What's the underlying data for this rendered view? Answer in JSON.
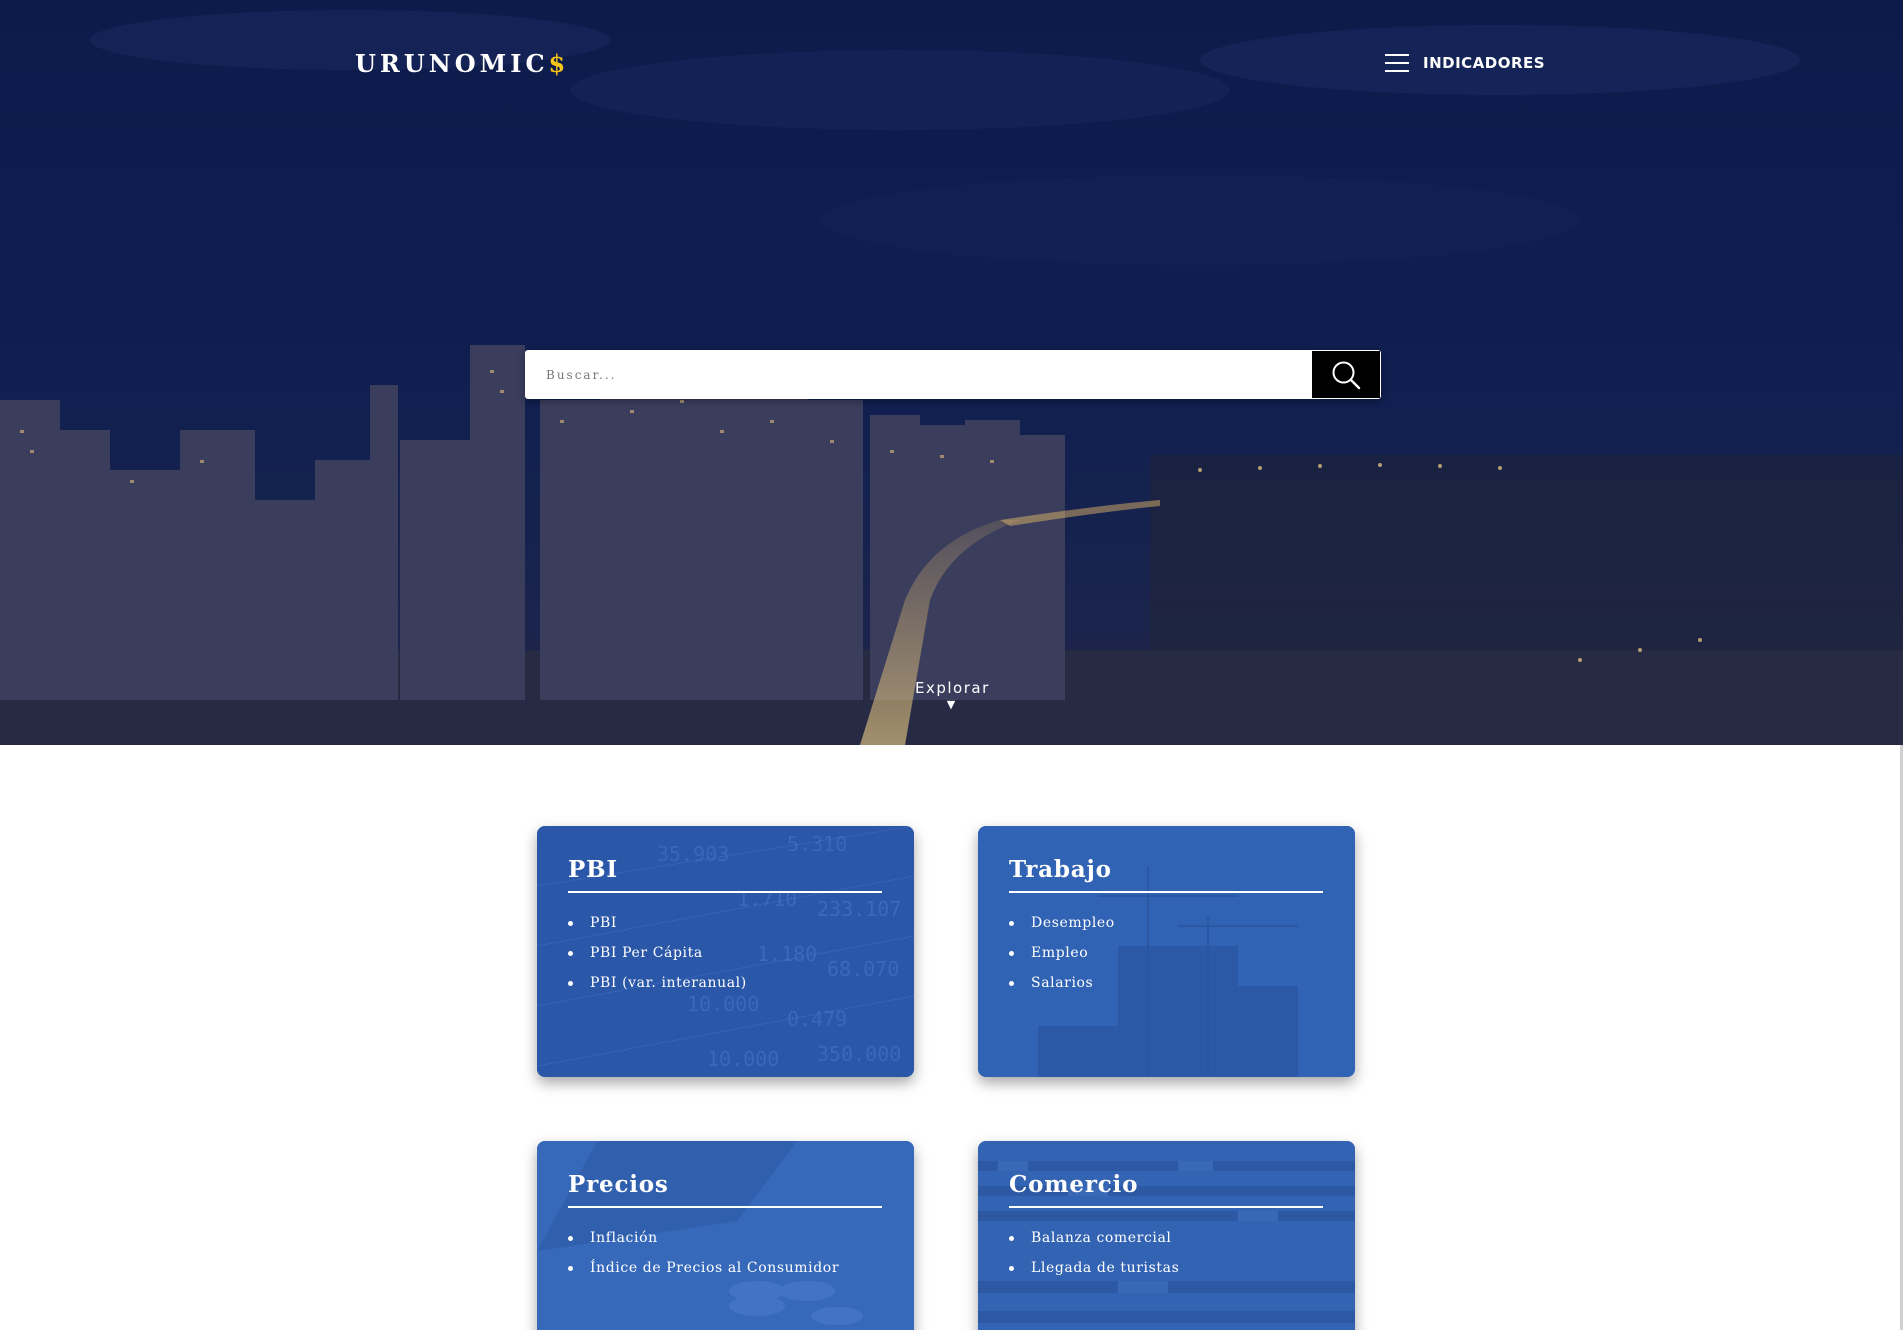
{
  "brand": {
    "name": "URUNOMIC",
    "symbol": "$"
  },
  "nav": {
    "menu_label": "INDICADORES",
    "menu_icon": "hamburger-menu-icon"
  },
  "search": {
    "placeholder": "Buscar...",
    "value": "",
    "button_icon": "search-icon"
  },
  "explore": {
    "label": "Explorar",
    "arrow": "▼"
  },
  "cards": [
    {
      "title": "PBI",
      "items": [
        "PBI",
        "PBI Per Cápita",
        "PBI (var. interanual)"
      ]
    },
    {
      "title": "Trabajo",
      "items": [
        "Desempleo",
        "Empleo",
        "Salarios"
      ]
    },
    {
      "title": "Precios",
      "items": [
        "Inflación",
        "Índice de Precios al Consumidor"
      ]
    },
    {
      "title": "Comercio",
      "items": [
        "Balanza comercial",
        "Llegada de turistas"
      ]
    }
  ],
  "colors": {
    "hero_overlay": "#0d1b4a",
    "accent_symbol": "#f5c518",
    "card_blue": "#2d5bb0",
    "search_button": "#000000"
  }
}
